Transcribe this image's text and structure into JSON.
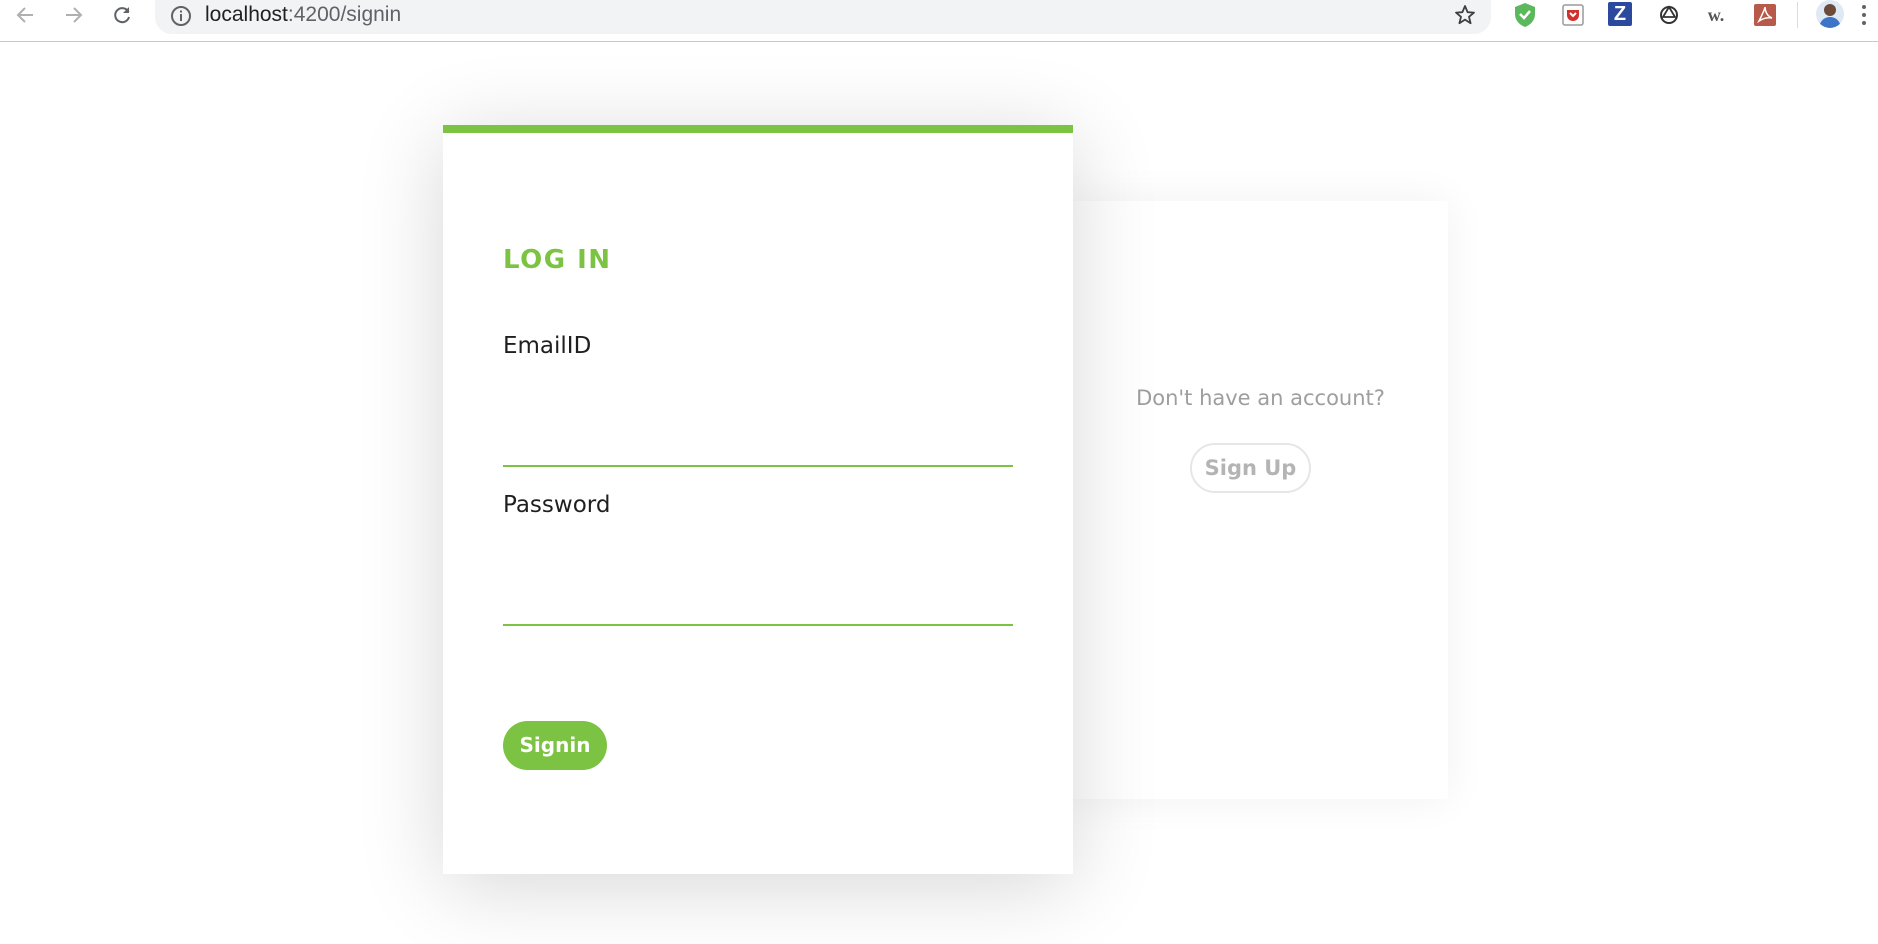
{
  "browser": {
    "url_host": "localhost",
    "url_path": ":4200/signin"
  },
  "login": {
    "title": "LOG IN",
    "email_label": "EmailID",
    "email_value": "",
    "password_label": "Password",
    "password_value": "",
    "signin_label": "Signin"
  },
  "signup_panel": {
    "prompt": "Don't have an account?",
    "signup_label": "Sign Up"
  },
  "colors": {
    "accent": "#7cc243",
    "muted_text": "#9e9e9e",
    "button_border": "#e6e6e6"
  }
}
